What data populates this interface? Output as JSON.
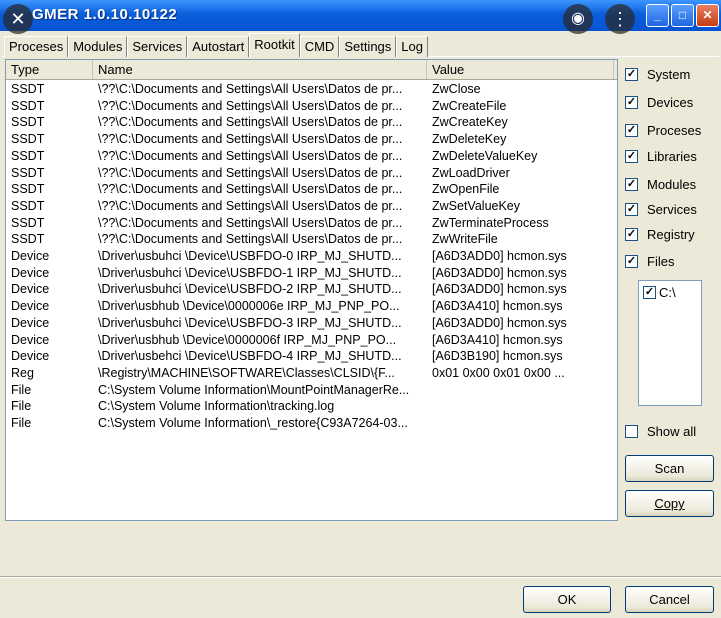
{
  "window": {
    "title": "GMER 1.0.10.10122"
  },
  "tabs": [
    "Proceses",
    "Modules",
    "Services",
    "Autostart",
    "Rootkit",
    "CMD",
    "Settings",
    "Log"
  ],
  "active_tab": "Rootkit",
  "table": {
    "headers": [
      "Type",
      "Name",
      "Value"
    ],
    "rows": [
      [
        "SSDT",
        "\\??\\C:\\Documents and Settings\\All Users\\Datos de pr...",
        "ZwClose"
      ],
      [
        "SSDT",
        "\\??\\C:\\Documents and Settings\\All Users\\Datos de pr...",
        "ZwCreateFile"
      ],
      [
        "SSDT",
        "\\??\\C:\\Documents and Settings\\All Users\\Datos de pr...",
        "ZwCreateKey"
      ],
      [
        "SSDT",
        "\\??\\C:\\Documents and Settings\\All Users\\Datos de pr...",
        "ZwDeleteKey"
      ],
      [
        "SSDT",
        "\\??\\C:\\Documents and Settings\\All Users\\Datos de pr...",
        "ZwDeleteValueKey"
      ],
      [
        "SSDT",
        "\\??\\C:\\Documents and Settings\\All Users\\Datos de pr...",
        "ZwLoadDriver"
      ],
      [
        "SSDT",
        "\\??\\C:\\Documents and Settings\\All Users\\Datos de pr...",
        "ZwOpenFile"
      ],
      [
        "SSDT",
        "\\??\\C:\\Documents and Settings\\All Users\\Datos de pr...",
        "ZwSetValueKey"
      ],
      [
        "SSDT",
        "\\??\\C:\\Documents and Settings\\All Users\\Datos de pr...",
        "ZwTerminateProcess"
      ],
      [
        "SSDT",
        "\\??\\C:\\Documents and Settings\\All Users\\Datos de pr...",
        "ZwWriteFile"
      ],
      [
        "Device",
        "\\Driver\\usbuhci \\Device\\USBFDO-0 IRP_MJ_SHUTD...",
        "[A6D3ADD0] hcmon.sys"
      ],
      [
        "Device",
        "\\Driver\\usbuhci \\Device\\USBFDO-1 IRP_MJ_SHUTD...",
        "[A6D3ADD0] hcmon.sys"
      ],
      [
        "Device",
        "\\Driver\\usbuhci \\Device\\USBFDO-2 IRP_MJ_SHUTD...",
        "[A6D3ADD0] hcmon.sys"
      ],
      [
        "Device",
        "\\Driver\\usbhub \\Device\\0000006e IRP_MJ_PNP_PO...",
        "[A6D3A410] hcmon.sys"
      ],
      [
        "Device",
        "\\Driver\\usbuhci \\Device\\USBFDO-3 IRP_MJ_SHUTD...",
        "[A6D3ADD0] hcmon.sys"
      ],
      [
        "Device",
        "\\Driver\\usbhub \\Device\\0000006f IRP_MJ_PNP_PO...",
        "[A6D3A410] hcmon.sys"
      ],
      [
        "Device",
        "\\Driver\\usbehci \\Device\\USBFDO-4 IRP_MJ_SHUTD...",
        "[A6D3B190] hcmon.sys"
      ],
      [
        "Reg",
        "\\Registry\\MACHINE\\SOFTWARE\\Classes\\CLSID\\{F...",
        "0x01 0x00 0x01 0x00 ..."
      ],
      [
        "File",
        "C:\\System Volume Information\\MountPointManagerRe...",
        ""
      ],
      [
        "File",
        "C:\\System Volume Information\\tracking.log",
        ""
      ],
      [
        "File",
        "C:\\System Volume Information\\_restore{C93A7264-03...",
        ""
      ]
    ]
  },
  "options": [
    {
      "label": "System",
      "checked": true
    },
    {
      "label": "Devices",
      "checked": true
    },
    {
      "label": "Proceses",
      "checked": true
    },
    {
      "label": "Libraries",
      "checked": true
    },
    {
      "label": "Modules",
      "checked": true
    },
    {
      "label": "Services",
      "checked": true
    },
    {
      "label": "Registry",
      "checked": true
    },
    {
      "label": "Files",
      "checked": true
    }
  ],
  "drives": [
    {
      "label": "C:\\",
      "checked": true
    }
  ],
  "show_all": {
    "label": "Show all",
    "checked": false
  },
  "buttons": {
    "scan": "Scan",
    "copy": "Copy",
    "ok": "OK",
    "cancel": "Cancel"
  },
  "icons": {
    "close_overlay": "✕",
    "lens_overlay": "◉",
    "more_overlay": "⋮",
    "min": "_",
    "max": "□",
    "close": "✕"
  }
}
